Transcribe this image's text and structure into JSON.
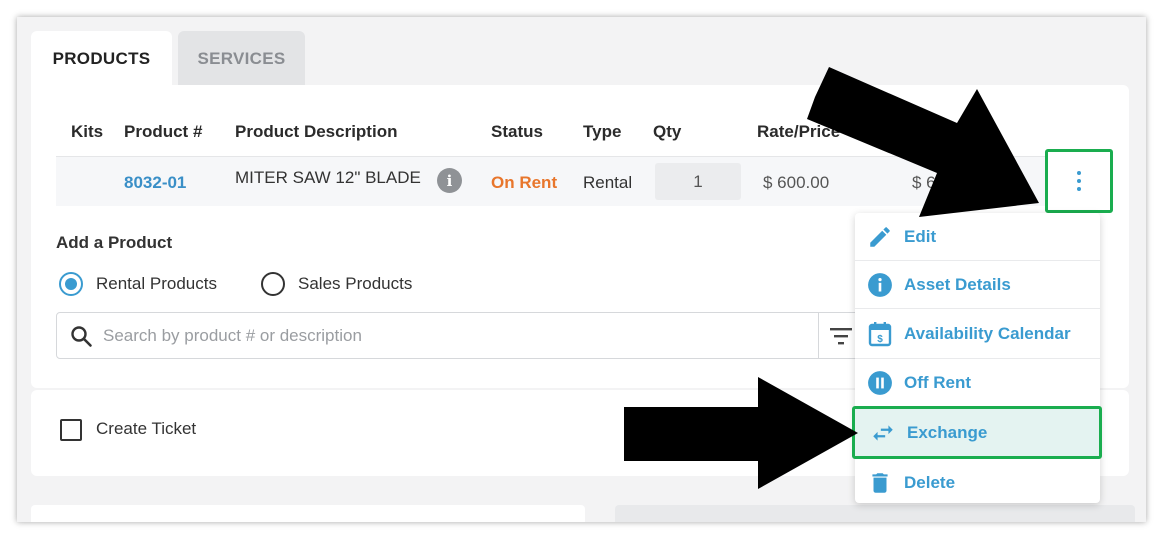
{
  "tabs": {
    "products": "PRODUCTS",
    "services": "SERVICES"
  },
  "table": {
    "headers": [
      "Kits",
      "Product #",
      "Product Description",
      "Status",
      "Type",
      "Qty",
      "Rate/Price"
    ],
    "row": {
      "product_number": "8032-01",
      "description": "MITER SAW 12\" BLADE",
      "status": "On Rent",
      "type": "Rental",
      "qty": "1",
      "rate": "$ 600.00",
      "total": "$ 60"
    }
  },
  "add_product": {
    "label": "Add a Product",
    "options": [
      "Rental Products",
      "Sales Products"
    ],
    "selected": "Rental Products",
    "search_placeholder": "Search by product # or description"
  },
  "ticket": {
    "label": "Create Ticket"
  },
  "menu": {
    "items": [
      {
        "label": "Edit",
        "icon": "pencil-icon"
      },
      {
        "label": "Asset Details",
        "icon": "info-icon"
      },
      {
        "label": "Availability Calendar",
        "icon": "calendar-dollar-icon"
      },
      {
        "label": "Off Rent",
        "icon": "pause-icon"
      },
      {
        "label": "Exchange",
        "icon": "exchange-arrows-icon"
      },
      {
        "label": "Delete",
        "icon": "trash-icon"
      }
    ],
    "highlighted": "Exchange"
  },
  "colors": {
    "accent": "#3a9bd0",
    "link": "#3a8fc7",
    "status_on_rent": "#e8762c",
    "highlight_border": "#1aad4f",
    "highlight_bg": "#e4f3f1"
  }
}
